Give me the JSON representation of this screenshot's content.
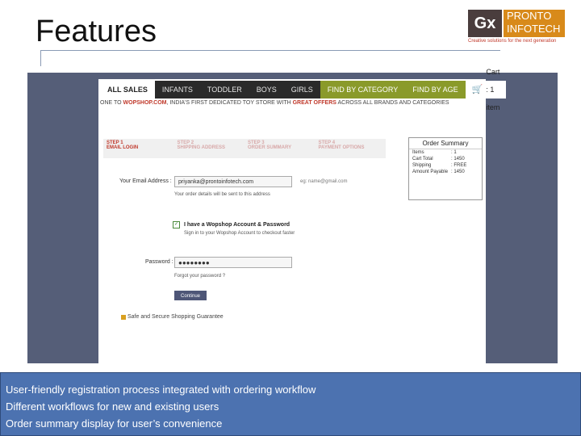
{
  "slide": {
    "title": "Features",
    "logo": {
      "mark": "Gx",
      "line1": "PRONTO",
      "line2": "INFOTECH",
      "tagline": "Creative solutions for the next generation"
    }
  },
  "nav": {
    "items": [
      "ALL SALES",
      "INFANTS",
      "TODDLER",
      "BOYS",
      "GIRLS",
      "FIND BY CATEGORY",
      "FIND BY AGE"
    ],
    "cart_label": "Cart : 1 item"
  },
  "banner": {
    "prefix": "ONE TO ",
    "site": "WOPSHOP.COM",
    "middle": ", INDIA'S FIRST DEDICATED TOY STORE WITH ",
    "highlight": "GREAT OFFERS",
    "suffix": " ACROSS ALL BRANDS AND CATEGORIES"
  },
  "steps": [
    {
      "num": "STEP 1",
      "name": "EMAIL LOGIN"
    },
    {
      "num": "STEP 2",
      "name": "SHIPPING ADDRESS"
    },
    {
      "num": "STEP 3",
      "name": "ORDER SUMMARY"
    },
    {
      "num": "STEP 4",
      "name": "PAYMENT OPTIONS"
    }
  ],
  "order_summary": {
    "title": "Order Summary",
    "rows": [
      {
        "k": "Items",
        "v": ": 1"
      },
      {
        "k": "Cart Total",
        "v": ": 1450"
      },
      {
        "k": "Shipping",
        "v": ": FREE"
      },
      {
        "k": "Amount Payable",
        "v": ": 1450"
      }
    ]
  },
  "form": {
    "email_label": "Your Email Address :",
    "email_value": "priyanka@prontoinfotech.com",
    "email_hint": "eg: name@gmail.com",
    "email_note": "Your order details will be sent to this address",
    "checkbox_label": "I have a Wopshop Account & Password",
    "checkbox_note": "Sign in to your Wopshop Account to checkout faster",
    "password_label": "Password :",
    "password_value": "●●●●●●●●",
    "forgot": "Forgot your password ?",
    "continue_label": "Continue",
    "safe_label": "Safe and Secure Shopping Guarantee"
  },
  "notes": [
    "User-friendly registration process integrated with ordering workflow",
    "Different workflows for new and existing users",
    "Order summary display for user’s convenience"
  ],
  "colors": {
    "background": "#555e78",
    "nav_bg": "#2a2a2a",
    "category_tab": "#8a9a2a",
    "step_red": "#c0392b",
    "notes_bg": "#4c72b0"
  }
}
